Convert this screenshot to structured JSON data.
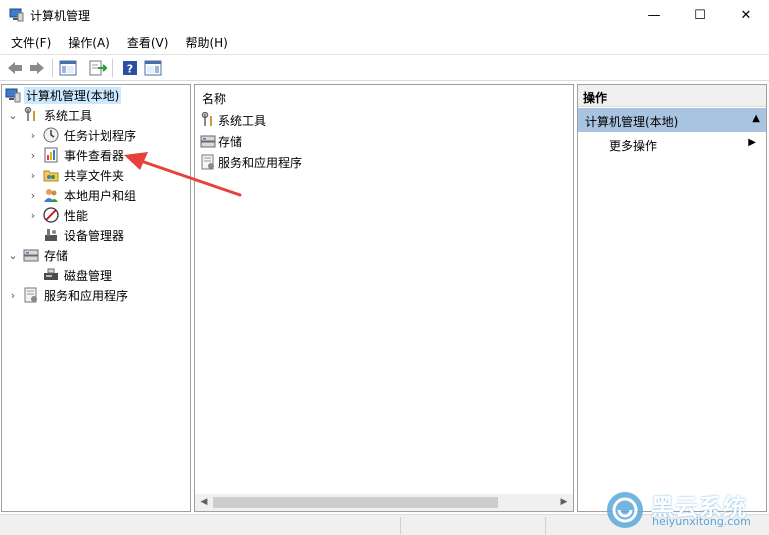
{
  "window": {
    "title": "计算机管理",
    "minimize_glyph": "—",
    "maximize_glyph": "☐",
    "close_glyph": "✕"
  },
  "menu": {
    "items": [
      "文件(F)",
      "操作(A)",
      "查看(V)",
      "帮助(H)"
    ]
  },
  "toolbar": {
    "buttons": [
      "back-icon",
      "forward-icon",
      "show-hide-tree-icon",
      "export-list-icon",
      "help-icon",
      "show-hide-action-pane-icon"
    ]
  },
  "tree": {
    "root": {
      "label": "计算机管理(本地)",
      "icon": "computer-management-icon"
    },
    "system_tools": {
      "label": "系统工具",
      "icon": "tools-icon",
      "expanded": true
    },
    "children": [
      {
        "label": "任务计划程序",
        "icon": "clock-icon",
        "expander": "›"
      },
      {
        "label": "事件查看器",
        "icon": "event-viewer-icon",
        "expander": "›"
      },
      {
        "label": "共享文件夹",
        "icon": "shared-folder-icon",
        "expander": "›"
      },
      {
        "label": "本地用户和组",
        "icon": "users-icon",
        "expander": "›"
      },
      {
        "label": "性能",
        "icon": "performance-icon",
        "expander": "›"
      },
      {
        "label": "设备管理器",
        "icon": "device-manager-icon",
        "expander": ""
      }
    ],
    "storage": {
      "label": "存储",
      "icon": "storage-icon",
      "expanded": true
    },
    "storage_children": [
      {
        "label": "磁盘管理",
        "icon": "disk-icon"
      }
    ],
    "services": {
      "label": "服务和应用程序",
      "icon": "services-icon",
      "expanded": false
    }
  },
  "list": {
    "column_header": "名称",
    "rows": [
      {
        "label": "系统工具",
        "icon": "tools-icon"
      },
      {
        "label": "存储",
        "icon": "storage-icon"
      },
      {
        "label": "服务和应用程序",
        "icon": "services-icon"
      }
    ]
  },
  "actions": {
    "header": "操作",
    "section": "计算机管理(本地)",
    "items": [
      {
        "label": "更多操作"
      }
    ]
  },
  "watermark": {
    "name": "黑云系统",
    "url": "heiyunxitong.com"
  },
  "colors": {
    "selection": "#cce8ff",
    "action_section": "#a8c4e0",
    "arrow": "#e8413a",
    "watermark": "#5aa7dc"
  }
}
